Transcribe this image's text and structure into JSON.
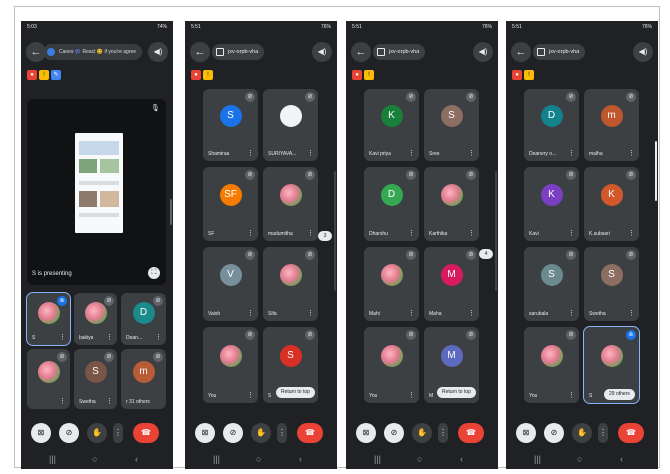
{
  "phones": [
    {
      "status_time": "5:03",
      "status_right": "74%",
      "toast": "Canes 🎆 React 😊 if you're agree",
      "presentation": {
        "label": "S is presenting"
      },
      "tiles": [
        {
          "name": "S",
          "avatar": "",
          "photo": true,
          "speaking": true
        },
        {
          "name": "bakiya",
          "avatar": "",
          "photo": true
        },
        {
          "name": "Dean...",
          "avatar": "D",
          "color": "#1a8a8a"
        },
        {
          "name": "",
          "avatar": "",
          "photo": true
        },
        {
          "name": "Swetha",
          "avatar": "S",
          "color": "#795548"
        },
        {
          "name": "r 31 others",
          "avatar": "m",
          "color": "#b85c38"
        }
      ]
    },
    {
      "status_time": "5:51",
      "status_right": "76%",
      "meeting_code": "jxv-orpb-vha",
      "page_indicator": "3",
      "return_label": "Return to top",
      "tiles": [
        {
          "name": "Shamiraa",
          "avatar": "S",
          "color": "#1a73e8"
        },
        {
          "name": "SURIYAVA...",
          "avatar": "",
          "white": true
        },
        {
          "name": "SF",
          "avatar": "SF",
          "color": "#f57c00"
        },
        {
          "name": "madumitha",
          "avatar": "",
          "photo": true
        },
        {
          "name": "Vaish",
          "avatar": "V",
          "color": "#78909c"
        },
        {
          "name": "Sifa",
          "avatar": "",
          "photo": true
        },
        {
          "name": "You",
          "avatar": "",
          "photo": true
        },
        {
          "name": "S",
          "avatar": "S",
          "color": "#d93025"
        }
      ]
    },
    {
      "status_time": "5:51",
      "status_right": "76%",
      "meeting_code": "jxv-orpb-vha",
      "page_indicator": "4",
      "return_label": "Return to top",
      "tiles": [
        {
          "name": "Kavi priya",
          "avatar": "K",
          "color": "#188038"
        },
        {
          "name": "Sree",
          "avatar": "S",
          "color": "#8d6e63"
        },
        {
          "name": "Dharshu",
          "avatar": "D",
          "color": "#34a853"
        },
        {
          "name": "Karthika",
          "avatar": "",
          "photo": true
        },
        {
          "name": "Mahi",
          "avatar": "",
          "photo": true
        },
        {
          "name": "Maha",
          "avatar": "M",
          "color": "#d81b60"
        },
        {
          "name": "You",
          "avatar": "",
          "photo": true
        },
        {
          "name": "M",
          "avatar": "M",
          "color": "#5c6bc0"
        }
      ]
    },
    {
      "status_time": "5:51",
      "status_right": "76%",
      "meeting_code": "jxv-orpb-vha",
      "tiles": [
        {
          "name": "Deanery o...",
          "avatar": "D",
          "color": "#12838a"
        },
        {
          "name": "malha",
          "avatar": "m",
          "color": "#c0562c"
        },
        {
          "name": "Kavi",
          "avatar": "K",
          "color": "#7b3fc4"
        },
        {
          "name": "K.subasri",
          "avatar": "K",
          "color": "#d2572a"
        },
        {
          "name": "sarubala",
          "avatar": "S",
          "color": "#6a8a90"
        },
        {
          "name": "Swetha",
          "avatar": "S",
          "color": "#8d6e63"
        },
        {
          "name": "You",
          "avatar": "",
          "photo": true
        },
        {
          "name": "29 others",
          "avatar": "",
          "photo": true,
          "speaking": true,
          "prefix": "S"
        }
      ]
    }
  ],
  "colors": {
    "bg": "#202124",
    "tile": "#3c4043",
    "end_call": "#ea4335",
    "accent": "#8ab4f8"
  },
  "icons": {
    "back": "arrow-left-icon",
    "audio": "speaker-icon",
    "camera_off": "camera-off-icon",
    "mic_off": "mic-off-icon",
    "hand": "raise-hand-icon",
    "more": "more-vert-icon",
    "end": "end-call-icon"
  }
}
